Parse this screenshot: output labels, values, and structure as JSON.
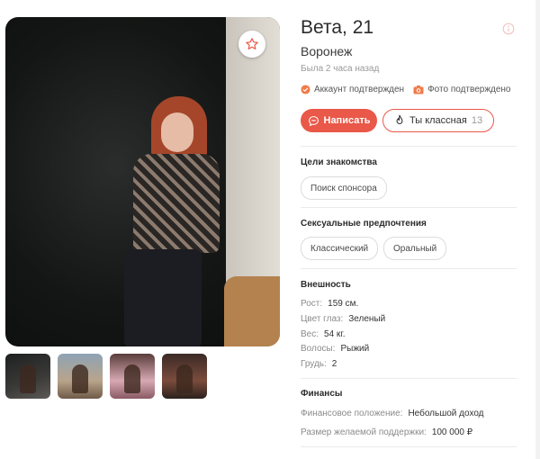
{
  "profile": {
    "name_age": "Вета, 21",
    "city": "Воронеж",
    "last_seen": "Была 2 часа назад",
    "account_verified": "Аккаунт подтвержден",
    "photo_verified": "Фото подтверждено"
  },
  "actions": {
    "write_label": "Написать",
    "compliment_label": "Ты классная",
    "compliment_count": "13"
  },
  "goals": {
    "title": "Цели знакомства",
    "items": [
      "Поиск спонсора"
    ]
  },
  "preferences": {
    "title": "Сексуальные предпочтения",
    "items": [
      "Классический",
      "Оральный"
    ]
  },
  "appearance": {
    "title": "Внешность",
    "rows": [
      {
        "label": "Рост:",
        "value": "159 см."
      },
      {
        "label": "Цвет глаз:",
        "value": "Зеленый"
      },
      {
        "label": "Вес:",
        "value": "54 кг."
      },
      {
        "label": "Волосы:",
        "value": "Рыжий"
      },
      {
        "label": "Грудь:",
        "value": "2"
      }
    ]
  },
  "finance": {
    "title": "Финансы",
    "rows": [
      {
        "label": "Финансовое положение:",
        "value": "Небольшой доход"
      },
      {
        "label": "Размер желаемой поддержки:",
        "value": "100 000 ₽"
      }
    ]
  },
  "colors": {
    "accent": "#e95848",
    "verified": "#f07b4a"
  },
  "icons": {
    "favorite": "star-icon",
    "info": "info-icon",
    "verified": "check-circle-icon",
    "photo": "camera-icon",
    "message": "chat-bubble-icon",
    "compliment": "flame-icon"
  }
}
